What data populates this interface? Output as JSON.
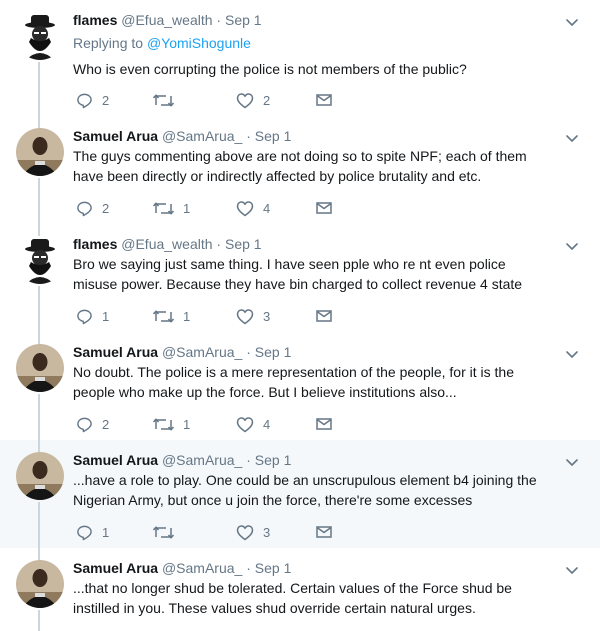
{
  "tweets": [
    {
      "name": "flames",
      "handle": "@Efua_wealth",
      "sep": " · ",
      "date": "Sep 1",
      "replying_prefix": "Replying to ",
      "replying_handle": "@YomiShogunle",
      "text": "Who is even corrupting the police is not members of the public?",
      "replies": "2",
      "retweets": "",
      "likes": "2",
      "avatar": "dark-hat-silhouette",
      "highlighted": false
    },
    {
      "name": "Samuel Arua",
      "handle": "@SamArua_",
      "sep": " · ",
      "date": "Sep 1",
      "text": "The guys commenting above are not doing so to spite NPF; each of them have been directly or indirectly affected by police brutality and etc.",
      "replies": "2",
      "retweets": "1",
      "likes": "4",
      "avatar": "photo",
      "highlighted": false
    },
    {
      "name": "flames",
      "handle": "@Efua_wealth",
      "sep": " · ",
      "date": "Sep 1",
      "text": "Bro we saying just same thing. I have seen pple who re nt even police misuse power. Because they have bin charged to collect revenue 4 state",
      "replies": "1",
      "retweets": "1",
      "likes": "3",
      "avatar": "dark-hat-silhouette",
      "highlighted": false
    },
    {
      "name": "Samuel Arua",
      "handle": "@SamArua_",
      "sep": " · ",
      "date": "Sep 1",
      "text": "No doubt. The police is a mere representation of the people, for it is the people who make up the force. But I believe institutions also...",
      "replies": "2",
      "retweets": "1",
      "likes": "4",
      "avatar": "photo",
      "highlighted": false
    },
    {
      "name": "Samuel Arua",
      "handle": "@SamArua_",
      "sep": " · ",
      "date": "Sep 1",
      "text": "...have a role to play. One could be an unscrupulous element b4 joining the Nigerian Army, but once u join the force, there're some excesses",
      "replies": "1",
      "retweets": "",
      "likes": "3",
      "avatar": "photo",
      "highlighted": true
    },
    {
      "name": "Samuel Arua",
      "handle": "@SamArua_",
      "sep": " · ",
      "date": "Sep 1",
      "text": "...that no longer shud be tolerated. Certain values of the Force shud be instilled in you. These values shud override certain natural urges.",
      "replies": "",
      "retweets": "",
      "likes": "",
      "avatar": "photo",
      "highlighted": false
    }
  ],
  "icons": {
    "reply": "reply-icon",
    "retweet": "retweet-icon",
    "like": "heart-icon",
    "dm": "envelope-icon",
    "menu": "chevron-down-icon"
  },
  "colors": {
    "name": "#14171a",
    "meta": "#657786",
    "link": "#1da1f2",
    "thread_line": "#ccd6dd",
    "highlight_bg": "#f5f8fa"
  }
}
